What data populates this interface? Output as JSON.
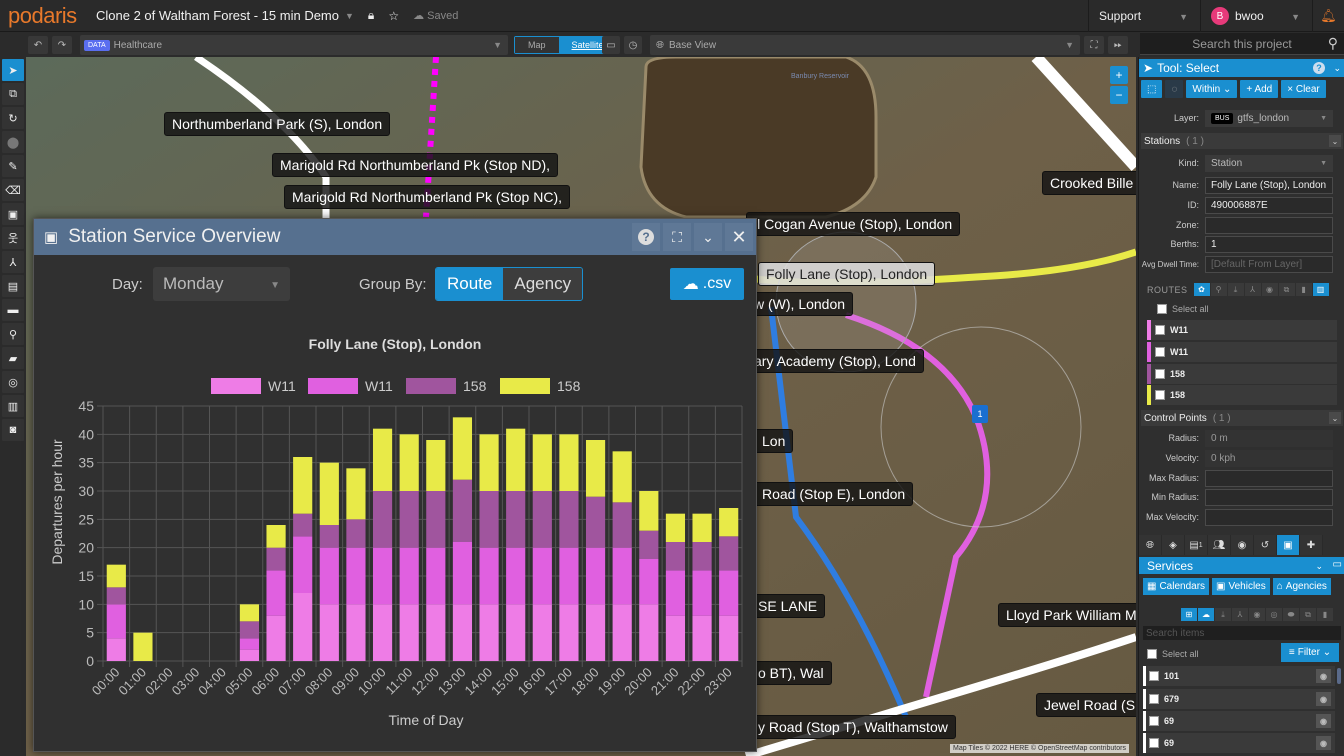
{
  "topbar": {
    "logo": "podaris",
    "project_title": "Clone 2 of Waltham Forest - 15 min Demo",
    "saved_status": "Saved",
    "support_label": "Support",
    "user_initial": "B",
    "user_name": "bwoo"
  },
  "toolbar": {
    "data_badge": "DATA",
    "data_layer": "Healthcare",
    "map_label": "Map",
    "satellite_label": "Satellite",
    "base_view": "Base View",
    "search_placeholder": "Search this project"
  },
  "map": {
    "labels": [
      "Northumberland Park (S), London",
      "Marigold Rd Northumberland Pk (Stop ND),",
      "Marigold Rd Northumberland Pk (Stop NC),",
      "Crooked Bille",
      "ll Cogan Avenue (Stop), London",
      "Folly Lane (Stop), London",
      "w (W), London",
      "ary Academy (Stop), Lond",
      "Lon",
      "Road (Stop E), London",
      "SE LANE",
      "Lloyd Park William M",
      "o BT), Wal",
      "Jewel Road (S",
      "y Road (Stop T), Walthamstow"
    ],
    "reservoir_name": "Banbury Reservoir",
    "control_point_marker": "1",
    "attribution": "Map Tiles © 2022 HERE © OpenStreetMap contributors"
  },
  "dialog": {
    "title": "Station Service Overview",
    "day_label": "Day:",
    "day_value": "Monday",
    "group_by_label": "Group By:",
    "group_route": "Route",
    "group_agency": "Agency",
    "csv_label": ".csv"
  },
  "chart_data": {
    "type": "bar",
    "stacked": true,
    "title": "Folly Lane (Stop), London",
    "xlabel": "Time of Day",
    "ylabel": "Departures per hour",
    "ylim": [
      0,
      45
    ],
    "yticks": [
      0,
      5,
      10,
      15,
      20,
      25,
      30,
      35,
      40,
      45
    ],
    "grid": true,
    "legend_position": "top",
    "categories": [
      "00:00",
      "01:00",
      "02:00",
      "03:00",
      "04:00",
      "05:00",
      "06:00",
      "07:00",
      "08:00",
      "09:00",
      "10:00",
      "11:00",
      "12:00",
      "13:00",
      "14:00",
      "15:00",
      "16:00",
      "17:00",
      "18:00",
      "19:00",
      "20:00",
      "21:00",
      "22:00",
      "23:00"
    ],
    "series": [
      {
        "name": "W11",
        "color": "#ee7ce6",
        "values": [
          4,
          0,
          0,
          0,
          0,
          2,
          8,
          12,
          10,
          10,
          10,
          10,
          10,
          10,
          10,
          10,
          10,
          10,
          10,
          10,
          10,
          8,
          8,
          8
        ]
      },
      {
        "name": "W11",
        "color": "#e060e0",
        "values": [
          6,
          0,
          0,
          0,
          0,
          2,
          8,
          10,
          10,
          10,
          10,
          10,
          10,
          11,
          10,
          10,
          10,
          10,
          10,
          10,
          8,
          8,
          8,
          8
        ]
      },
      {
        "name": "158",
        "color": "#a0559e",
        "values": [
          3,
          0,
          0,
          0,
          0,
          3,
          4,
          4,
          4,
          5,
          10,
          10,
          10,
          11,
          10,
          10,
          10,
          10,
          9,
          8,
          5,
          5,
          5,
          6
        ]
      },
      {
        "name": "158",
        "color": "#e8ea48",
        "values": [
          4,
          5,
          0,
          0,
          0,
          3,
          4,
          10,
          11,
          9,
          11,
          10,
          9,
          11,
          10,
          11,
          10,
          10,
          10,
          9,
          7,
          5,
          5,
          5
        ]
      }
    ]
  },
  "right_panel": {
    "tool_title": "Tool: Select",
    "within_label": "Within",
    "add_label": "+ Add",
    "clear_label": "× Clear",
    "layer_label": "Layer:",
    "layer_badge": "BUS",
    "layer_value": "gtfs_london",
    "stations_header": "Stations",
    "stations_count": "( 1 )",
    "fields": [
      {
        "label": "Kind:",
        "value": "Station"
      },
      {
        "label": "Name:",
        "value": "Folly Lane (Stop), London"
      },
      {
        "label": "ID:",
        "value": "490006887E"
      },
      {
        "label": "Zone:",
        "value": ""
      },
      {
        "label": "Berths:",
        "value": "1"
      },
      {
        "label": "Avg Dwell Time:",
        "value": "",
        "placeholder": "[Default From Layer]"
      }
    ],
    "routes_label": "ROUTES",
    "select_all": "Select all",
    "routes": [
      {
        "name": "W11",
        "color": "#ee7ce6"
      },
      {
        "name": "W11",
        "color": "#e060e0"
      },
      {
        "name": "158",
        "color": "#a0559e"
      },
      {
        "name": "158",
        "color": "#e8ea48"
      }
    ],
    "control_points_header": "Control Points",
    "control_points_count": "( 1 )",
    "cp_fields": [
      {
        "label": "Radius:",
        "value": "0 m"
      },
      {
        "label": "Velocity:",
        "value": "0 kph"
      },
      {
        "label": "Max Radius:",
        "value": ""
      },
      {
        "label": "Min Radius:",
        "value": ""
      },
      {
        "label": "Max Velocity:",
        "value": ""
      }
    ],
    "comments_count": "1",
    "services_header": "Services",
    "calendars_label": "Calendars",
    "vehicles_label": "Vehicles",
    "agencies_label": "Agencies",
    "search_items_placeholder": "Search items",
    "filter_label": "Filter",
    "services": [
      "101",
      "679",
      "69",
      "69"
    ]
  },
  "colors": {
    "accent": "#1a8fd0",
    "logo": "#e8792b",
    "dialog_header": "#56708f"
  }
}
